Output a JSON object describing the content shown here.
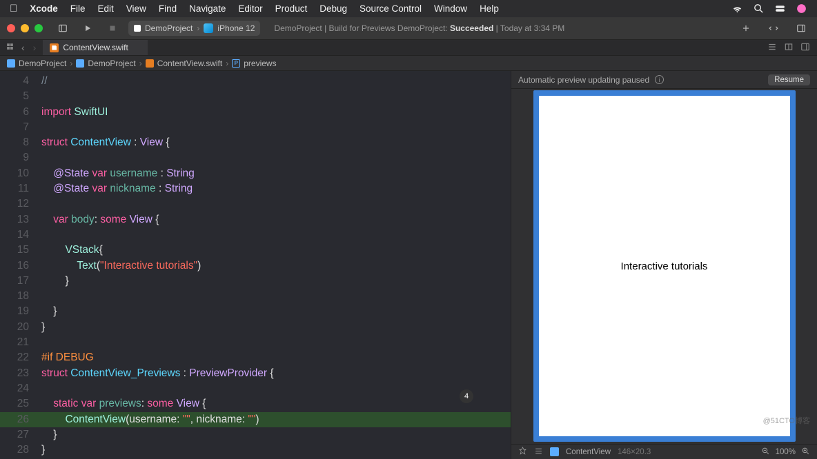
{
  "menubar": {
    "app": "Xcode",
    "items": [
      "File",
      "Edit",
      "View",
      "Find",
      "Navigate",
      "Editor",
      "Product",
      "Debug",
      "Source Control",
      "Window",
      "Help"
    ]
  },
  "toolbar": {
    "scheme_project": "DemoProject",
    "scheme_device": "iPhone 12",
    "status_prefix": "DemoProject | Build for Previews DemoProject: ",
    "status_result": "Succeeded",
    "status_suffix": " | Today at 3:34 PM"
  },
  "tab": {
    "filename": "ContentView.swift"
  },
  "breadcrumb": {
    "items": [
      "DemoProject",
      "DemoProject",
      "ContentView.swift",
      "previews"
    ]
  },
  "code": {
    "lines": [
      {
        "n": 4,
        "t": [
          [
            "c-comment",
            "//"
          ]
        ]
      },
      {
        "n": 5,
        "t": []
      },
      {
        "n": 6,
        "t": [
          [
            "c-keyword",
            "import"
          ],
          [
            "c-plain",
            " "
          ],
          [
            "c-type2",
            "SwiftUI"
          ]
        ]
      },
      {
        "n": 7,
        "t": []
      },
      {
        "n": 8,
        "t": [
          [
            "c-keyword",
            "struct"
          ],
          [
            "c-plain",
            " "
          ],
          [
            "c-type",
            "ContentView"
          ],
          [
            "c-plain",
            " : "
          ],
          [
            "c-ptype",
            "View"
          ],
          [
            "c-plain",
            " {"
          ]
        ]
      },
      {
        "n": 9,
        "t": []
      },
      {
        "n": 10,
        "t": [
          [
            "c-plain",
            "    "
          ],
          [
            "c-atstate",
            "@State"
          ],
          [
            "c-plain",
            " "
          ],
          [
            "c-keyword",
            "var"
          ],
          [
            "c-plain",
            " "
          ],
          [
            "c-id",
            "username"
          ],
          [
            "c-plain",
            " : "
          ],
          [
            "c-ptype",
            "String"
          ]
        ]
      },
      {
        "n": 11,
        "t": [
          [
            "c-plain",
            "    "
          ],
          [
            "c-atstate",
            "@State"
          ],
          [
            "c-plain",
            " "
          ],
          [
            "c-keyword",
            "var"
          ],
          [
            "c-plain",
            " "
          ],
          [
            "c-id",
            "nickname"
          ],
          [
            "c-plain",
            " : "
          ],
          [
            "c-ptype",
            "String"
          ]
        ]
      },
      {
        "n": 12,
        "t": []
      },
      {
        "n": 13,
        "t": [
          [
            "c-plain",
            "    "
          ],
          [
            "c-keyword",
            "var"
          ],
          [
            "c-plain",
            " "
          ],
          [
            "c-body",
            "body"
          ],
          [
            "c-plain",
            ": "
          ],
          [
            "c-keyword",
            "some"
          ],
          [
            "c-plain",
            " "
          ],
          [
            "c-ptype",
            "View"
          ],
          [
            "c-plain",
            " {"
          ]
        ]
      },
      {
        "n": 14,
        "t": []
      },
      {
        "n": 15,
        "t": [
          [
            "c-plain",
            "        "
          ],
          [
            "c-type2",
            "VStack"
          ],
          [
            "c-plain",
            "{"
          ]
        ]
      },
      {
        "n": 16,
        "t": [
          [
            "c-plain",
            "            "
          ],
          [
            "c-type2",
            "Text"
          ],
          [
            "c-plain",
            "("
          ],
          [
            "c-string",
            "\"Interactive tutorials\""
          ],
          [
            "c-plain",
            ")"
          ]
        ]
      },
      {
        "n": 17,
        "t": [
          [
            "c-plain",
            "        }"
          ]
        ]
      },
      {
        "n": 18,
        "t": []
      },
      {
        "n": 19,
        "t": [
          [
            "c-plain",
            "    }"
          ]
        ]
      },
      {
        "n": 20,
        "t": [
          [
            "c-plain",
            "}"
          ]
        ]
      },
      {
        "n": 21,
        "t": []
      },
      {
        "n": 22,
        "t": [
          [
            "c-prep",
            "#if DEBUG"
          ]
        ]
      },
      {
        "n": 23,
        "t": [
          [
            "c-keyword",
            "struct"
          ],
          [
            "c-plain",
            " "
          ],
          [
            "c-type",
            "ContentView_Previews"
          ],
          [
            "c-plain",
            " : "
          ],
          [
            "c-ptype",
            "PreviewProvider"
          ],
          [
            "c-plain",
            " {"
          ]
        ]
      },
      {
        "n": 24,
        "t": []
      },
      {
        "n": 25,
        "t": [
          [
            "c-plain",
            "    "
          ],
          [
            "c-keyword",
            "static"
          ],
          [
            "c-plain",
            " "
          ],
          [
            "c-keyword",
            "var"
          ],
          [
            "c-plain",
            " "
          ],
          [
            "c-body",
            "previews"
          ],
          [
            "c-plain",
            ": "
          ],
          [
            "c-keyword",
            "some"
          ],
          [
            "c-plain",
            " "
          ],
          [
            "c-ptype",
            "View"
          ],
          [
            "c-plain",
            " {"
          ]
        ]
      },
      {
        "n": 26,
        "hl": true,
        "t": [
          [
            "c-plain",
            "        "
          ],
          [
            "c-type2",
            "ContentView"
          ],
          [
            "c-plain",
            "(username: "
          ],
          [
            "c-string",
            "\"\""
          ],
          [
            "c-plain",
            ", nickname: "
          ],
          [
            "c-string",
            "\"\""
          ],
          [
            "c-plain",
            ")"
          ]
        ]
      },
      {
        "n": 27,
        "t": [
          [
            "c-plain",
            "    }"
          ]
        ]
      },
      {
        "n": 28,
        "t": [
          [
            "c-plain",
            "}"
          ]
        ]
      }
    ],
    "issue_count": "4"
  },
  "preview": {
    "bar_text": "Automatic preview updating paused",
    "resume": "Resume",
    "device_text": "Interactive tutorials",
    "footer_label": "ContentView",
    "footer_size": "146×20.3",
    "zoom": "100%"
  },
  "watermark": "@51CTO博客"
}
